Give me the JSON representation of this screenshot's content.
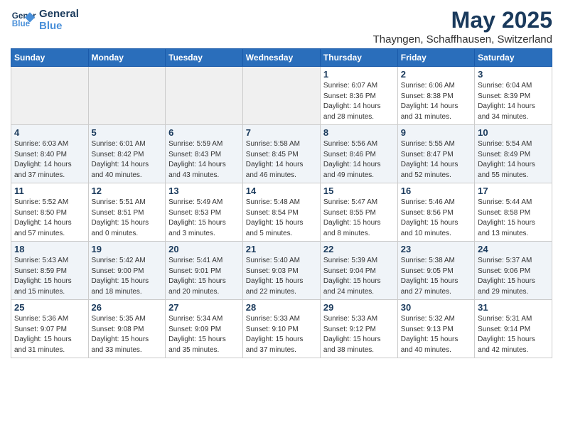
{
  "logo": {
    "line1": "General",
    "line2": "Blue"
  },
  "title": "May 2025",
  "subtitle": "Thayngen, Schaffhausen, Switzerland",
  "weekdays": [
    "Sunday",
    "Monday",
    "Tuesday",
    "Wednesday",
    "Thursday",
    "Friday",
    "Saturday"
  ],
  "weeks": [
    [
      {
        "day": "",
        "info": ""
      },
      {
        "day": "",
        "info": ""
      },
      {
        "day": "",
        "info": ""
      },
      {
        "day": "",
        "info": ""
      },
      {
        "day": "1",
        "info": "Sunrise: 6:07 AM\nSunset: 8:36 PM\nDaylight: 14 hours\nand 28 minutes."
      },
      {
        "day": "2",
        "info": "Sunrise: 6:06 AM\nSunset: 8:38 PM\nDaylight: 14 hours\nand 31 minutes."
      },
      {
        "day": "3",
        "info": "Sunrise: 6:04 AM\nSunset: 8:39 PM\nDaylight: 14 hours\nand 34 minutes."
      }
    ],
    [
      {
        "day": "4",
        "info": "Sunrise: 6:03 AM\nSunset: 8:40 PM\nDaylight: 14 hours\nand 37 minutes."
      },
      {
        "day": "5",
        "info": "Sunrise: 6:01 AM\nSunset: 8:42 PM\nDaylight: 14 hours\nand 40 minutes."
      },
      {
        "day": "6",
        "info": "Sunrise: 5:59 AM\nSunset: 8:43 PM\nDaylight: 14 hours\nand 43 minutes."
      },
      {
        "day": "7",
        "info": "Sunrise: 5:58 AM\nSunset: 8:45 PM\nDaylight: 14 hours\nand 46 minutes."
      },
      {
        "day": "8",
        "info": "Sunrise: 5:56 AM\nSunset: 8:46 PM\nDaylight: 14 hours\nand 49 minutes."
      },
      {
        "day": "9",
        "info": "Sunrise: 5:55 AM\nSunset: 8:47 PM\nDaylight: 14 hours\nand 52 minutes."
      },
      {
        "day": "10",
        "info": "Sunrise: 5:54 AM\nSunset: 8:49 PM\nDaylight: 14 hours\nand 55 minutes."
      }
    ],
    [
      {
        "day": "11",
        "info": "Sunrise: 5:52 AM\nSunset: 8:50 PM\nDaylight: 14 hours\nand 57 minutes."
      },
      {
        "day": "12",
        "info": "Sunrise: 5:51 AM\nSunset: 8:51 PM\nDaylight: 15 hours\nand 0 minutes."
      },
      {
        "day": "13",
        "info": "Sunrise: 5:49 AM\nSunset: 8:53 PM\nDaylight: 15 hours\nand 3 minutes."
      },
      {
        "day": "14",
        "info": "Sunrise: 5:48 AM\nSunset: 8:54 PM\nDaylight: 15 hours\nand 5 minutes."
      },
      {
        "day": "15",
        "info": "Sunrise: 5:47 AM\nSunset: 8:55 PM\nDaylight: 15 hours\nand 8 minutes."
      },
      {
        "day": "16",
        "info": "Sunrise: 5:46 AM\nSunset: 8:56 PM\nDaylight: 15 hours\nand 10 minutes."
      },
      {
        "day": "17",
        "info": "Sunrise: 5:44 AM\nSunset: 8:58 PM\nDaylight: 15 hours\nand 13 minutes."
      }
    ],
    [
      {
        "day": "18",
        "info": "Sunrise: 5:43 AM\nSunset: 8:59 PM\nDaylight: 15 hours\nand 15 minutes."
      },
      {
        "day": "19",
        "info": "Sunrise: 5:42 AM\nSunset: 9:00 PM\nDaylight: 15 hours\nand 18 minutes."
      },
      {
        "day": "20",
        "info": "Sunrise: 5:41 AM\nSunset: 9:01 PM\nDaylight: 15 hours\nand 20 minutes."
      },
      {
        "day": "21",
        "info": "Sunrise: 5:40 AM\nSunset: 9:03 PM\nDaylight: 15 hours\nand 22 minutes."
      },
      {
        "day": "22",
        "info": "Sunrise: 5:39 AM\nSunset: 9:04 PM\nDaylight: 15 hours\nand 24 minutes."
      },
      {
        "day": "23",
        "info": "Sunrise: 5:38 AM\nSunset: 9:05 PM\nDaylight: 15 hours\nand 27 minutes."
      },
      {
        "day": "24",
        "info": "Sunrise: 5:37 AM\nSunset: 9:06 PM\nDaylight: 15 hours\nand 29 minutes."
      }
    ],
    [
      {
        "day": "25",
        "info": "Sunrise: 5:36 AM\nSunset: 9:07 PM\nDaylight: 15 hours\nand 31 minutes."
      },
      {
        "day": "26",
        "info": "Sunrise: 5:35 AM\nSunset: 9:08 PM\nDaylight: 15 hours\nand 33 minutes."
      },
      {
        "day": "27",
        "info": "Sunrise: 5:34 AM\nSunset: 9:09 PM\nDaylight: 15 hours\nand 35 minutes."
      },
      {
        "day": "28",
        "info": "Sunrise: 5:33 AM\nSunset: 9:10 PM\nDaylight: 15 hours\nand 37 minutes."
      },
      {
        "day": "29",
        "info": "Sunrise: 5:33 AM\nSunset: 9:12 PM\nDaylight: 15 hours\nand 38 minutes."
      },
      {
        "day": "30",
        "info": "Sunrise: 5:32 AM\nSunset: 9:13 PM\nDaylight: 15 hours\nand 40 minutes."
      },
      {
        "day": "31",
        "info": "Sunrise: 5:31 AM\nSunset: 9:14 PM\nDaylight: 15 hours\nand 42 minutes."
      }
    ]
  ]
}
